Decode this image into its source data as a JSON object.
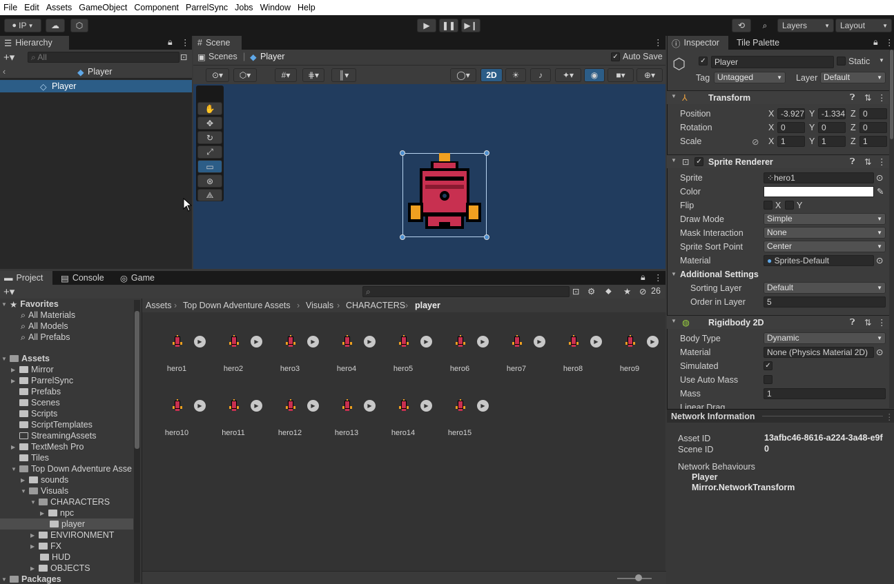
{
  "menu": [
    "File",
    "Edit",
    "Assets",
    "GameObject",
    "Component",
    "ParrelSync",
    "Jobs",
    "Window",
    "Help"
  ],
  "toolbar": {
    "account": "IP",
    "layers": "Layers",
    "layout": "Layout"
  },
  "hierarchy": {
    "tab": "Hierarchy",
    "search_placeholder": "All",
    "scene_root": "Player",
    "item": "Player"
  },
  "scene": {
    "tab": "Scene",
    "breadcrumb_root": "Scenes",
    "breadcrumb_current": "Player",
    "auto_save": "Auto Save",
    "mode_2d": "2D"
  },
  "bottom_tabs": {
    "project": "Project",
    "console": "Console",
    "game": "Game",
    "hidden_count": "26"
  },
  "project": {
    "favorites_label": "Favorites",
    "favorites": [
      "All Materials",
      "All Models",
      "All Prefabs"
    ],
    "assets_label": "Assets",
    "assets": [
      "Mirror",
      "ParrelSync",
      "Prefabs",
      "Scenes",
      "Scripts",
      "ScriptTemplates",
      "StreamingAssets",
      "TextMesh Pro",
      "Tiles"
    ],
    "tda": "Top Down Adventure Asse",
    "sounds": "sounds",
    "visuals": "Visuals",
    "characters": "CHARACTERS",
    "npc": "npc",
    "player": "player",
    "visual_sub": [
      "ENVIRONMENT",
      "FX",
      "HUD",
      "OBJECTS"
    ],
    "packages": "Packages",
    "breadcrumb": [
      "Assets",
      "Top Down Adventure Assets",
      "Visuals",
      "CHARACTERS",
      "player"
    ],
    "heroes": [
      "hero1",
      "hero2",
      "hero3",
      "hero4",
      "hero5",
      "hero6",
      "hero7",
      "hero8",
      "hero9",
      "hero10",
      "hero11",
      "hero12",
      "hero13",
      "hero14",
      "hero15"
    ]
  },
  "inspector": {
    "tab": "Inspector",
    "tab2": "Tile Palette",
    "name": "Player",
    "static": "Static",
    "tag_label": "Tag",
    "tag": "Untagged",
    "layer_label": "Layer",
    "layer": "Default",
    "transform": {
      "title": "Transform",
      "position": "Position",
      "rotation": "Rotation",
      "scale": "Scale",
      "pos": [
        "-3.927",
        "-1.334",
        "0"
      ],
      "rot": [
        "0",
        "0",
        "0"
      ],
      "scl": [
        "1",
        "1",
        "1"
      ]
    },
    "sprite_renderer": {
      "title": "Sprite Renderer",
      "sprite_label": "Sprite",
      "sprite": "hero1",
      "color_label": "Color",
      "flip_label": "Flip",
      "flip_x": "X",
      "flip_y": "Y",
      "draw_mode_label": "Draw Mode",
      "draw_mode": "Simple",
      "mask_label": "Mask Interaction",
      "mask": "None",
      "sort_point_label": "Sprite Sort Point",
      "sort_point": "Center",
      "material_label": "Material",
      "material": "Sprites-Default",
      "additional": "Additional Settings",
      "sorting_layer_label": "Sorting Layer",
      "sorting_layer": "Default",
      "order_label": "Order in Layer",
      "order": "5"
    },
    "rigidbody": {
      "title": "Rigidbody 2D",
      "body_type_label": "Body Type",
      "body_type": "Dynamic",
      "material_label": "Material",
      "material": "None (Physics Material 2D)",
      "simulated_label": "Simulated",
      "auto_mass_label": "Use Auto Mass",
      "mass_label": "Mass",
      "mass": "1",
      "linear_drag_label": "Linear Drag"
    },
    "network": {
      "title": "Network Information",
      "asset_id_label": "Asset ID",
      "asset_id": "13afbc46-8616-a224-3a48-e9f",
      "scene_id_label": "Scene ID",
      "scene_id": "0",
      "behaviours_label": "Network Behaviours",
      "behaviours": [
        "Player",
        "Mirror.NetworkTransform"
      ]
    }
  },
  "colors": {
    "accent": "#2c5d87",
    "scene_bg": "#213c5e",
    "selected": "#2c5d87"
  }
}
